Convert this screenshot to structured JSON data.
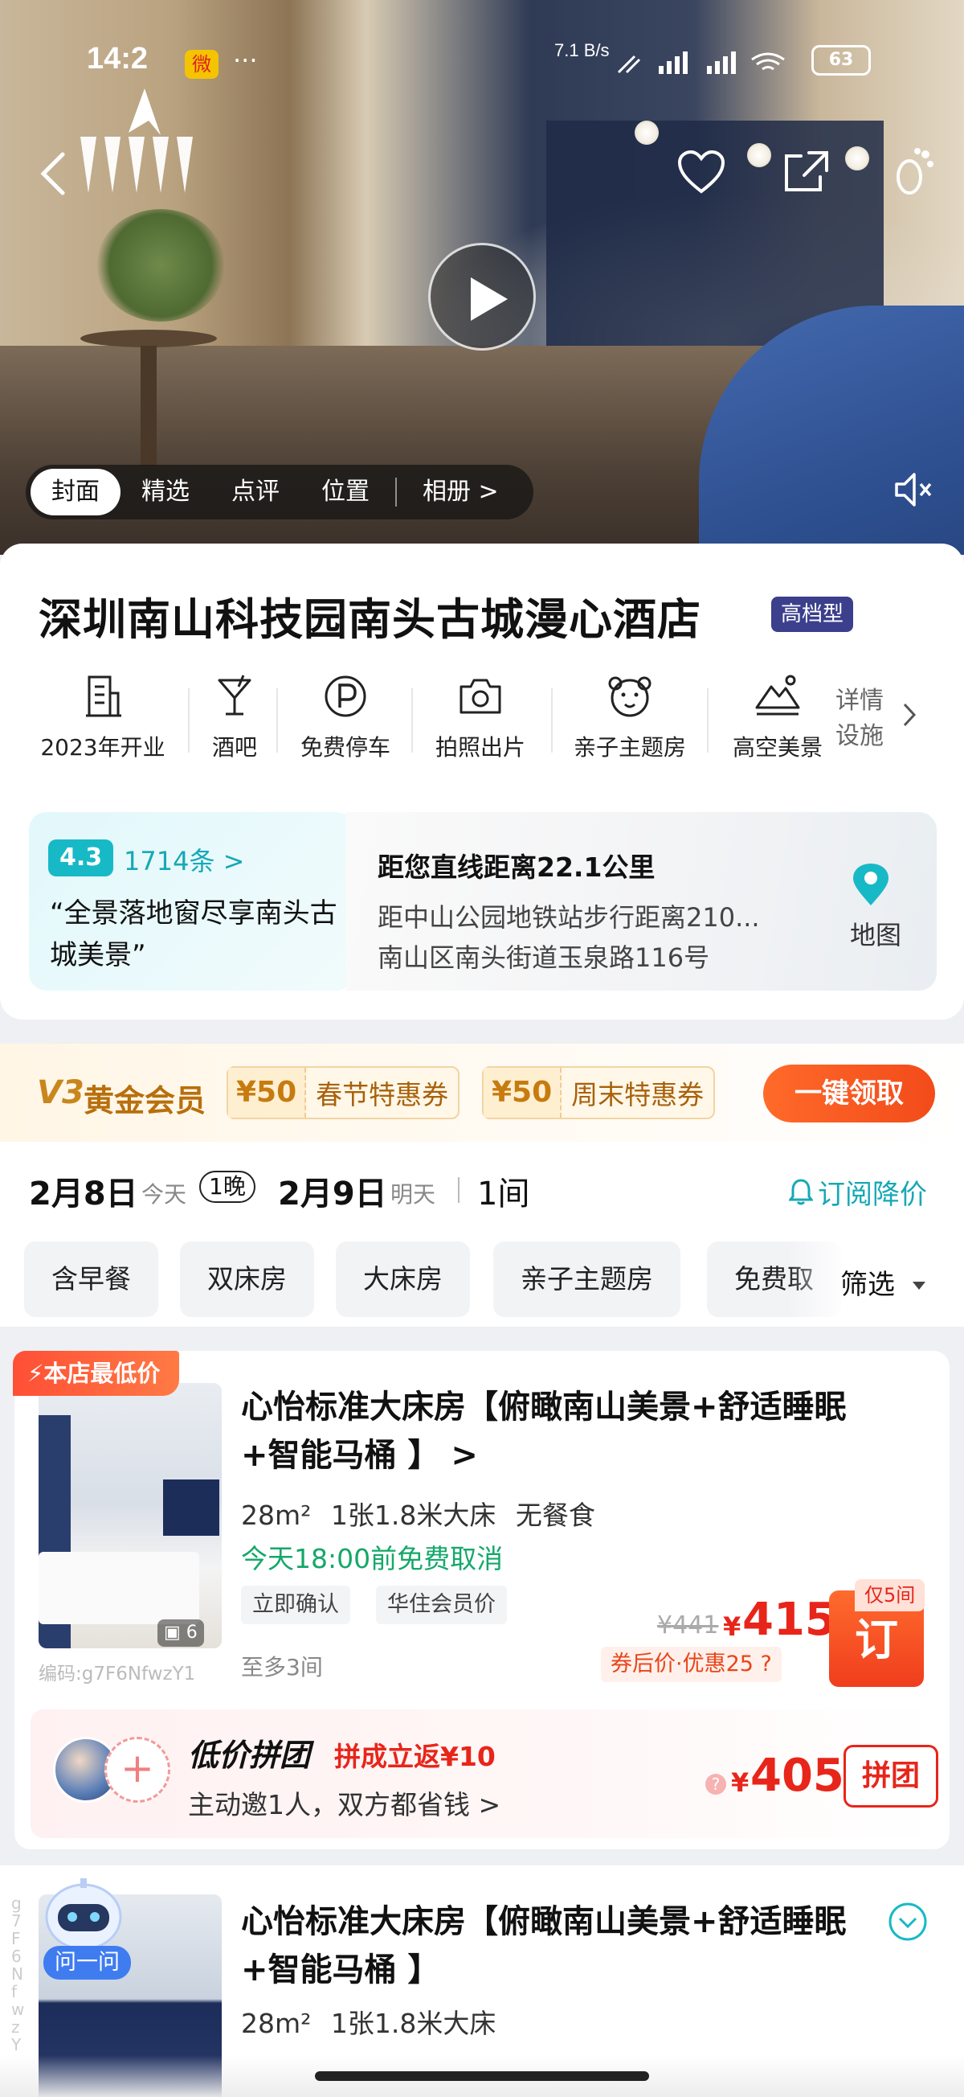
{
  "status_bar": {
    "time": "14:2",
    "weibo": "微",
    "dots": "···",
    "net_speed": "7.1 B/s",
    "battery": "63"
  },
  "hero": {
    "tabs": [
      {
        "label": "封面",
        "active": true
      },
      {
        "label": "精选",
        "active": false
      },
      {
        "label": "点评",
        "active": false
      },
      {
        "label": "位置",
        "active": false
      },
      {
        "label": "相册 >",
        "active": false
      }
    ]
  },
  "hotel": {
    "name": "深圳南山科技园南头古城漫心酒店",
    "grade": "高档型",
    "facilities": [
      {
        "label": "2023年开业",
        "icon": "building-icon"
      },
      {
        "label": "酒吧",
        "icon": "cocktail-icon"
      },
      {
        "label": "免费停车",
        "icon": "parking-icon"
      },
      {
        "label": "拍照出片",
        "icon": "camera-icon"
      },
      {
        "label": "亲子主题房",
        "icon": "bear-icon"
      },
      {
        "label": "高空美景",
        "icon": "mountain-icon"
      }
    ],
    "facilities_more": "详情设施",
    "review": {
      "score": "4.3",
      "count": "1714条 >",
      "quote": "“全景落地窗尽享南头古城美景”"
    },
    "location": {
      "distance": "距您直线距离22.1公里",
      "metro": "距中山公园地铁站步行距离210...",
      "address": "南山区南头街道玉泉路116号",
      "map_label": "地图"
    }
  },
  "member": {
    "badge": "V3",
    "title": "黄金会员",
    "coupons": [
      {
        "amount": "¥50",
        "name": "春节特惠券"
      },
      {
        "amount": "¥50",
        "name": "周末特惠券"
      }
    ],
    "claim": "一键领取"
  },
  "dates": {
    "checkin": "2月8日",
    "checkin_sub": "今天",
    "nights": "1晚",
    "checkout": "2月9日",
    "checkout_sub": "明天",
    "rooms": "1间",
    "subscribe": "订阅降价"
  },
  "filters": {
    "chips": [
      "含早餐",
      "双床房",
      "大床房",
      "亲子主题房",
      "免费取"
    ],
    "filter_label": "筛选"
  },
  "room1": {
    "tag": "本店最低价",
    "title": "心怡标准大床房【俯瞰南山美景+舒适睡眠+智能马桶 】 >",
    "meta": "28m² 1张1.8米大床 无餐食",
    "cancel": "今天18:00前免费取消",
    "tags": [
      "立即确认",
      "华住会员价"
    ],
    "image_count": "6",
    "code": "编码:g7F6NfwzY1",
    "max_rooms": "至多3间",
    "original_price": "¥441",
    "price": "415",
    "yen": "¥",
    "after_coupon": "券后价·优惠25 ?",
    "only_left": "仅5间",
    "book": "订",
    "group": {
      "title": "低价拼团",
      "cashback": "拼成立返¥10",
      "subtitle": "主动邀1人，双方都省钱 >",
      "price": "405",
      "button": "拼团"
    }
  },
  "room2": {
    "ask": "问一问",
    "title": "心怡标准大床房【俯瞰南山美景+舒适睡眠+智能马桶 】",
    "meta": "28m² 1张1.8米大床",
    "code_vertical": "g7F6NfwzY"
  },
  "colors": {
    "accent_teal": "#17a8b6",
    "price_red": "#e8251a",
    "gold": "#b86f0c",
    "cancel_green": "#14a86a"
  }
}
